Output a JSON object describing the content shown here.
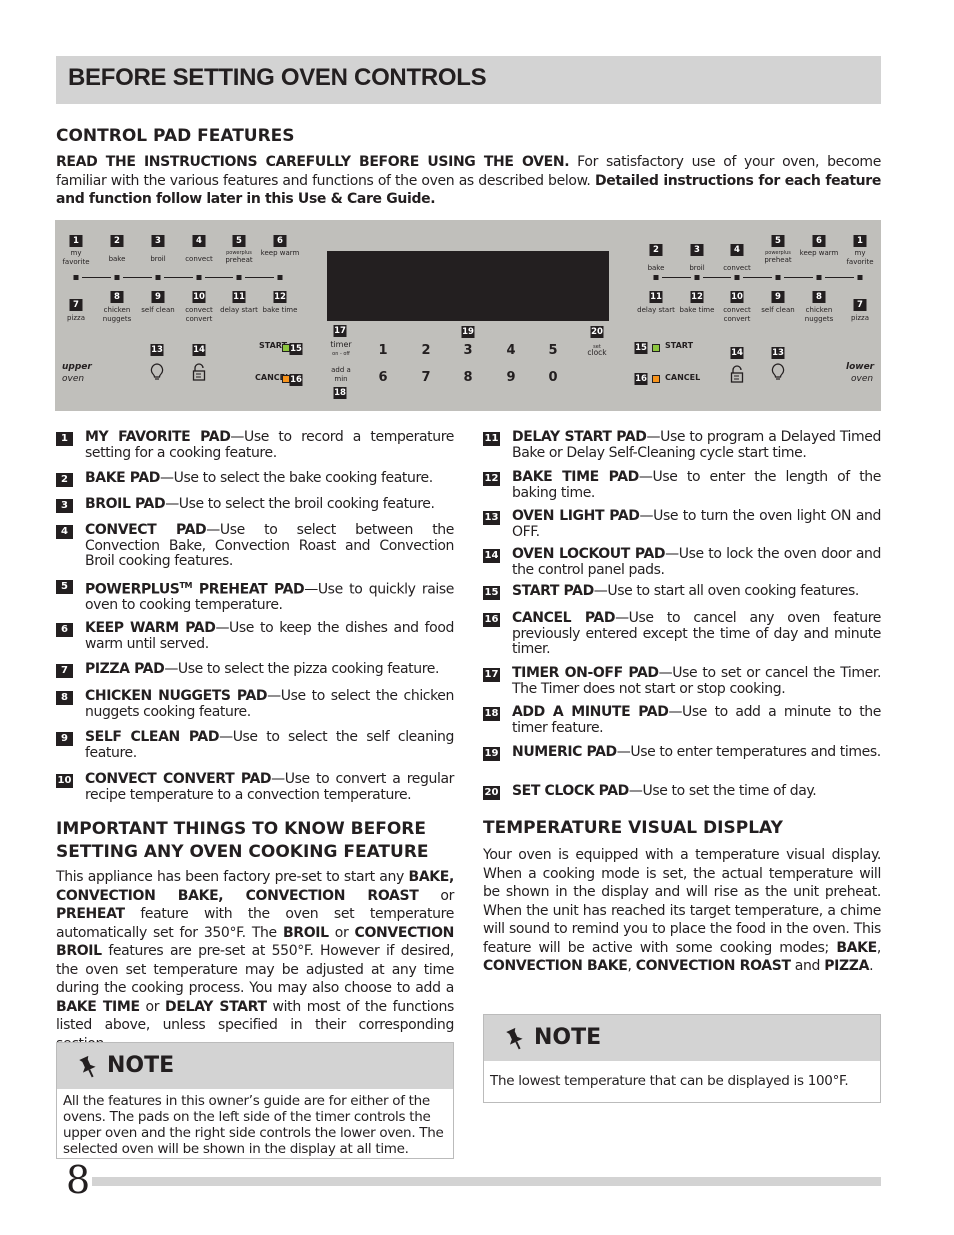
{
  "title": "BEFORE SETTING OVEN CONTROLS",
  "section1": {
    "heading": "CONTROL PAD FEATURES",
    "intro_bold1": "READ THE INSTRUCTIONS CAREFULLY BEFORE USING THE OVEN.",
    "intro_text": " For satisfactory use of your oven, become familiar with the various features and functions of the oven as described below. ",
    "intro_bold2": "Detailed instructions for each feature and function follow later in this Use & Care Guide."
  },
  "panel": {
    "upper": {
      "pads": [
        {
          "n": "1",
          "label": "my favorite"
        },
        {
          "n": "2",
          "label": "bake"
        },
        {
          "n": "3",
          "label": "broil"
        },
        {
          "n": "4",
          "label": "convect"
        },
        {
          "n": "5",
          "label_small": "powerplus",
          "label": "preheat"
        },
        {
          "n": "6",
          "label": "keep warm"
        },
        {
          "n": "7",
          "label": "pizza"
        },
        {
          "n": "8",
          "label": "chicken nuggets"
        },
        {
          "n": "9",
          "label": "self clean"
        },
        {
          "n": "10",
          "label": "convect convert"
        },
        {
          "n": "11",
          "label": "delay start"
        },
        {
          "n": "12",
          "label": "bake time"
        },
        {
          "n": "13",
          "icon": "light-bulb-icon"
        },
        {
          "n": "14",
          "icon": "lock-icon"
        },
        {
          "n": "15",
          "label": "START"
        },
        {
          "n": "16",
          "label": "CANCEL"
        }
      ],
      "oven_label": [
        "upper",
        "oven"
      ]
    },
    "center": {
      "n17": "17",
      "timer": "timer",
      "onoff": "on - off",
      "addmin": "add a min",
      "n18": "18",
      "n19": "19",
      "n20": "20",
      "set": "set",
      "clock": "clock",
      "digits": [
        "1",
        "2",
        "3",
        "4",
        "5",
        "6",
        "7",
        "8",
        "9",
        "0"
      ]
    },
    "lower": {
      "pads": [
        {
          "n": "2",
          "label": "bake"
        },
        {
          "n": "3",
          "label": "broil"
        },
        {
          "n": "4",
          "label": "convect"
        },
        {
          "n": "5",
          "label_small": "powerplus",
          "label": "preheat"
        },
        {
          "n": "6",
          "label": "keep warm"
        },
        {
          "n": "1",
          "label": "my favorite"
        },
        {
          "n": "11",
          "label": "delay start"
        },
        {
          "n": "12",
          "label": "bake time"
        },
        {
          "n": "10",
          "label": "convect convert"
        },
        {
          "n": "9",
          "label": "self clean"
        },
        {
          "n": "8",
          "label": "chicken nuggets"
        },
        {
          "n": "7",
          "label": "pizza"
        },
        {
          "n": "15",
          "label": "START"
        },
        {
          "n": "16",
          "label": "CANCEL"
        },
        {
          "n": "14",
          "icon": "lock-icon"
        },
        {
          "n": "13",
          "icon": "light-bulb-icon"
        }
      ],
      "oven_label": [
        "lower",
        "oven"
      ]
    },
    "colors": {
      "panel": "#c0bfbb",
      "start_led": "#8dc63f",
      "cancel_led": "#f7941d"
    }
  },
  "features": [
    {
      "n": "1",
      "name": "MY FAVORITE PAD",
      "desc": "—Use to record a temperature setting for a cooking feature."
    },
    {
      "n": "2",
      "name": "BAKE PAD",
      "desc": "—Use to select the bake cooking feature."
    },
    {
      "n": "3",
      "name": "BROIL PAD",
      "desc": "—Use to select the broil cooking feature."
    },
    {
      "n": "4",
      "name": "CONVECT PAD",
      "desc": "—Use to select between the Convection Bake, Convection Roast and Convection Broil cooking features."
    },
    {
      "n": "5",
      "name": "POWERPLUS",
      "tm": "TM",
      "name2": " PREHEAT PAD",
      "desc": "—Use to quickly raise oven to cooking temperature."
    },
    {
      "n": "6",
      "name": "KEEP WARM PAD",
      "desc": "—Use to keep the dishes and food warm until served."
    },
    {
      "n": "7",
      "name": "PIZZA PAD",
      "desc": "—Use to select the pizza cooking feature."
    },
    {
      "n": "8",
      "name": "CHICKEN NUGGETS PAD",
      "desc": "—Use to select the chicken nuggets cooking feature."
    },
    {
      "n": "9",
      "name": "SELF CLEAN PAD",
      "desc": "—Use to select the self cleaning feature."
    },
    {
      "n": "10",
      "name": "CONVECT CONVERT PAD",
      "desc": "—Use to convert a regular recipe temperature to a convection temperature."
    },
    {
      "n": "11",
      "name": "DELAY START PAD",
      "desc": "—Use to program a Delayed Timed Bake or Delay Self-Cleaning cycle start time."
    },
    {
      "n": "12",
      "name": "BAKE TIME PAD",
      "desc": "—Use to enter the length of the baking time."
    },
    {
      "n": "13",
      "name": "OVEN LIGHT PAD",
      "desc": "—Use to turn the oven light ON and OFF."
    },
    {
      "n": "14",
      "name": "OVEN LOCKOUT PAD",
      "desc": "—Use to lock the oven door and the control panel pads."
    },
    {
      "n": "15",
      "name": "START PAD",
      "desc": "—Use to start all oven cooking features."
    },
    {
      "n": "16",
      "name": "CANCEL PAD",
      "desc": "—Use to cancel any oven feature previously entered except the time of day and minute timer."
    },
    {
      "n": "17",
      "name": "TIMER ON-OFF PAD",
      "desc": "—Use to set or cancel the Timer. The Timer does not start or stop cooking."
    },
    {
      "n": "18",
      "name": "ADD A MINUTE PAD",
      "desc": "—Use to add a minute to the timer feature."
    },
    {
      "n": "19",
      "name": "NUMERIC PAD",
      "desc": "—Use to enter temperatures and times."
    },
    {
      "n": "20",
      "name": "SET CLOCK PAD",
      "desc": "—Use to set the time of day."
    }
  ],
  "important": {
    "heading": "IMPORTANT THINGS TO KNOW BEFORE SETTING ANY OVEN COOKING FEATURE",
    "segments": [
      [
        "t",
        "This appliance has been factory pre-set to start any "
      ],
      [
        "b",
        "BAKE, CONVECTION BAKE, CONVECTION ROAST"
      ],
      [
        "t",
        " or "
      ],
      [
        "b",
        "PREHEAT"
      ],
      [
        "t",
        " feature with the oven set temperature automatically set for 350°F. The "
      ],
      [
        "b",
        "BROIL"
      ],
      [
        "t",
        " or "
      ],
      [
        "b",
        "CONVECTION BROIL"
      ],
      [
        "t",
        " features are pre-set at 550°F. However if desired, the oven set temperature may be adjusted at any time during the cooking process. You may also choose to add a "
      ],
      [
        "b",
        "BAKE TIME"
      ],
      [
        "t",
        " or "
      ],
      [
        "b",
        "DELAY START"
      ],
      [
        "t",
        " with most of the functions listed above, unless specified in their corresponding section."
      ]
    ]
  },
  "temp_display": {
    "heading": "TEMPERATURE VISUAL DISPLAY",
    "segments": [
      [
        "t",
        "Your oven is equipped with a temperature visual display. When a cooking mode is set, the actual temperature will be shown in the display and will rise as the unit preheat. When the unit has reached its target temperature, a chime will sound to remind you to place the food in the oven. This feature will be active with some cooking modes; "
      ],
      [
        "b",
        "BAKE"
      ],
      [
        "t",
        ", "
      ],
      [
        "b",
        "CONVECTION BAKE"
      ],
      [
        "t",
        ", "
      ],
      [
        "b",
        "CONVECTION ROAST"
      ],
      [
        "t",
        " and "
      ],
      [
        "b",
        "PIZZA"
      ],
      [
        "t",
        "."
      ]
    ]
  },
  "note_left": {
    "title": "NOTE",
    "text": "All the features in this owner’s guide are for either of the ovens. The pads on the left side of the timer controls the upper oven and the right side controls the lower oven. The selected oven will be shown in the display at all time."
  },
  "note_right": {
    "title": "NOTE",
    "text": "The lowest temperature that can be displayed is 100°F."
  },
  "page_number": "8"
}
